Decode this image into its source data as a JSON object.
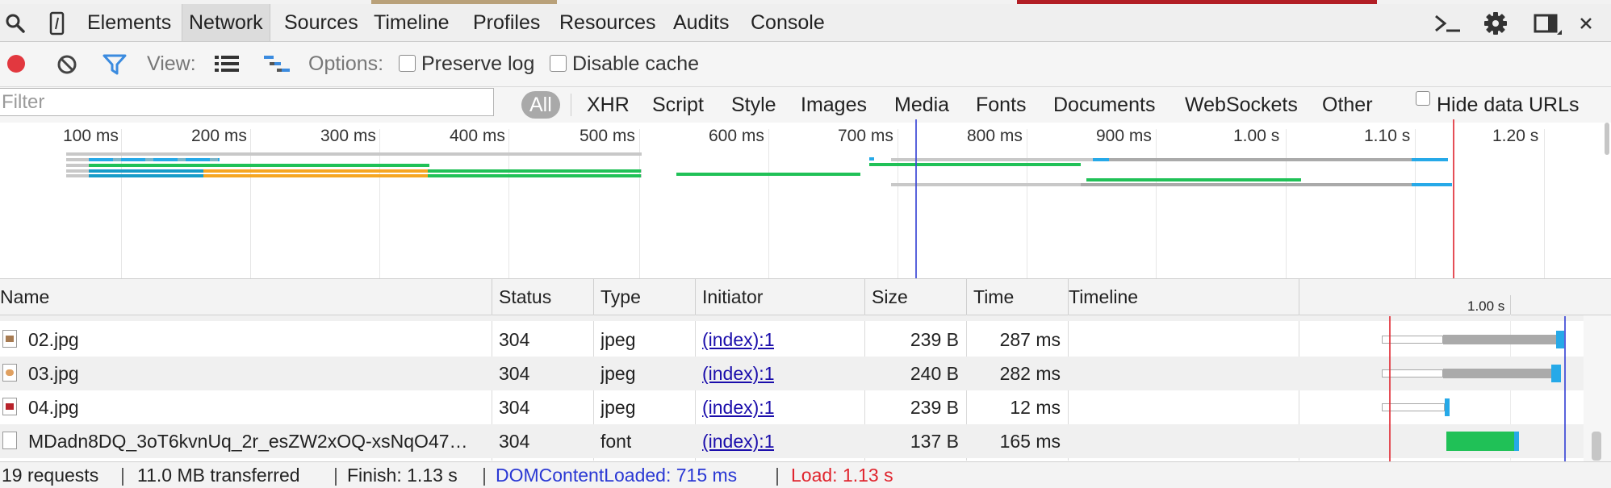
{
  "tabs": [
    "Elements",
    "Network",
    "Sources",
    "Timeline",
    "Profiles",
    "Resources",
    "Audits",
    "Console"
  ],
  "active_tab": "Network",
  "toolbar": {
    "view_label": "View:",
    "options_label": "Options:",
    "preserve_log": "Preserve log",
    "disable_cache": "Disable cache",
    "preserve_log_checked": false,
    "disable_cache_checked": false
  },
  "filter": {
    "placeholder": "Filter",
    "value": "",
    "types": [
      "All",
      "XHR",
      "Script",
      "Style",
      "Images",
      "Media",
      "Fonts",
      "Documents",
      "WebSockets",
      "Other"
    ],
    "active_type": "All",
    "hide_data_urls": "Hide data URLs",
    "hide_data_urls_checked": false
  },
  "overview": {
    "ticks": [
      "100 ms",
      "200 ms",
      "300 ms",
      "400 ms",
      "500 ms",
      "600 ms",
      "700 ms",
      "800 ms",
      "900 ms",
      "1.00 s",
      "1.10 s",
      "1.20 s"
    ],
    "dom_content_loaded_ms": 715,
    "load_ms": 1130
  },
  "table": {
    "columns": [
      "Name",
      "Status",
      "Type",
      "Initiator",
      "Size",
      "Time",
      "Timeline"
    ],
    "timeline_tick": "1.00 s",
    "rows": [
      {
        "name": "02.jpg",
        "status": "304",
        "type": "jpeg",
        "initiator": "(index):1",
        "size": "239 B",
        "time": "287 ms",
        "icon": "image-icon"
      },
      {
        "name": "03.jpg",
        "status": "304",
        "type": "jpeg",
        "initiator": "(index):1",
        "size": "240 B",
        "time": "282 ms",
        "icon": "image-icon"
      },
      {
        "name": "04.jpg",
        "status": "304",
        "type": "jpeg",
        "initiator": "(index):1",
        "size": "239 B",
        "time": "12 ms",
        "icon": "image-icon"
      },
      {
        "name": "MDadn8DQ_3oT6kvnUq_2r_esZW2xOQ-xsNqO47…",
        "status": "304",
        "type": "font",
        "initiator": "(index):1",
        "size": "137 B",
        "time": "165 ms",
        "icon": "file-icon"
      }
    ]
  },
  "status": {
    "requests": "19 requests",
    "transferred": "11.0 MB transferred",
    "finish": "Finish: 1.13 s",
    "dom_content_loaded": "DOMContentLoaded: 715 ms",
    "load": "Load: 1.13 s"
  },
  "colors": {
    "dcl_line": "#3c48d6",
    "load_line": "#e0303a",
    "waiting": "#aaaaaa",
    "download": "#26a9e8",
    "script_bar": "#20c157",
    "image_bar": "#f5a623",
    "record": "#e2383f",
    "filter_active": "#3b8bdf"
  }
}
